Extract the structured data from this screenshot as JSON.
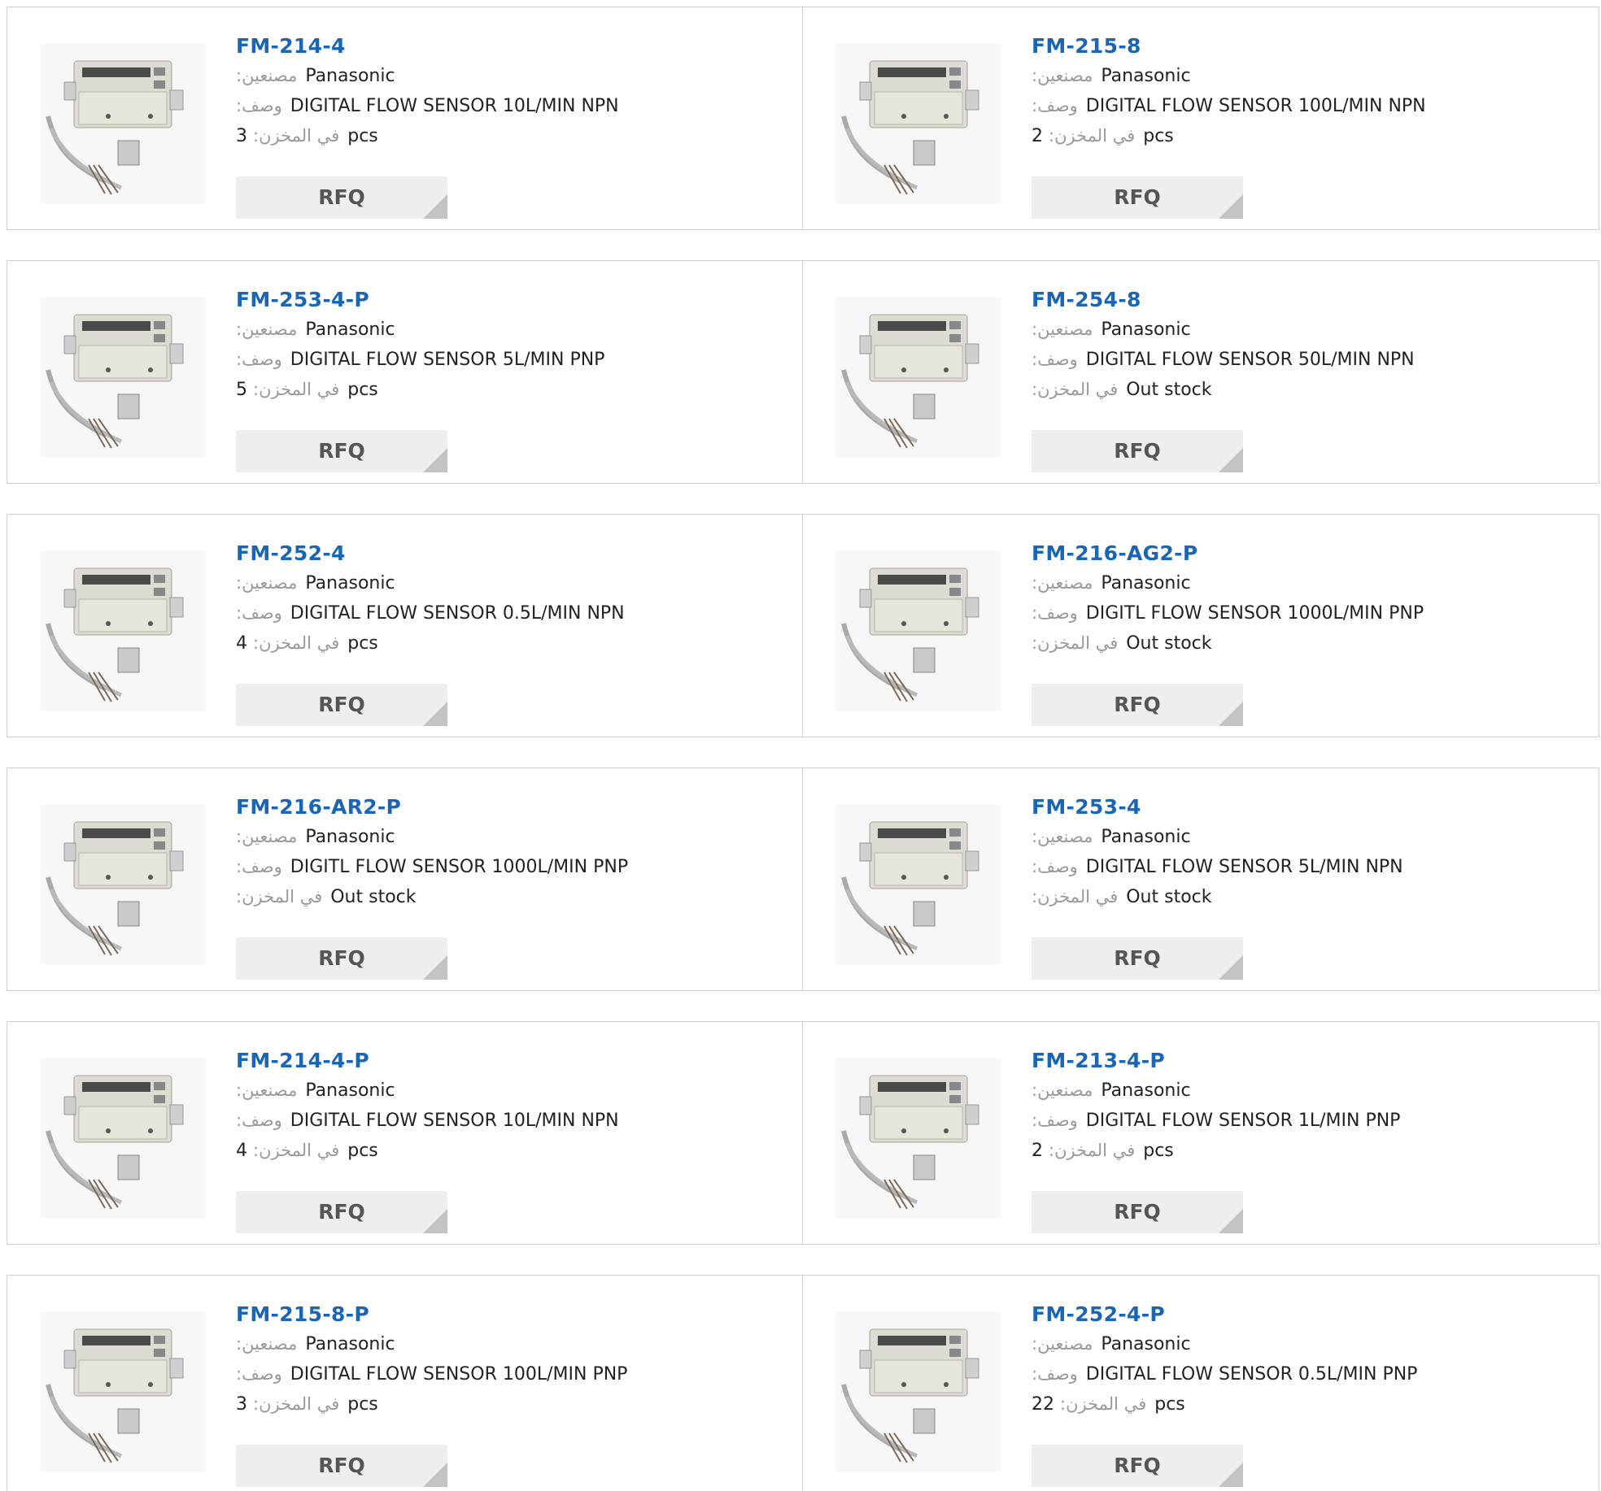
{
  "labels": {
    "manufacturer": ":مصنعين",
    "description": ":وصف",
    "stock": ":في المخزن",
    "unit": "pcs",
    "rfq": "RFQ"
  },
  "products": [
    {
      "part": "FM-214-4",
      "manufacturer": "Panasonic",
      "description": "DIGITAL FLOW SENSOR 10L/MIN NPN",
      "stock": "3",
      "in_stock": true
    },
    {
      "part": "FM-215-8",
      "manufacturer": "Panasonic",
      "description": "DIGITAL FLOW SENSOR 100L/MIN NPN",
      "stock": "2",
      "in_stock": true
    },
    {
      "part": "FM-253-4-P",
      "manufacturer": "Panasonic",
      "description": "DIGITAL FLOW SENSOR 5L/MIN PNP",
      "stock": "5",
      "in_stock": true
    },
    {
      "part": "FM-254-8",
      "manufacturer": "Panasonic",
      "description": "DIGITAL FLOW SENSOR 50L/MIN NPN",
      "stock": "Out stock",
      "in_stock": false
    },
    {
      "part": "FM-252-4",
      "manufacturer": "Panasonic",
      "description": "DIGITAL FLOW SENSOR 0.5L/MIN NPN",
      "stock": "4",
      "in_stock": true
    },
    {
      "part": "FM-216-AG2-P",
      "manufacturer": "Panasonic",
      "description": "DIGITL FLOW SENSOR 1000L/MIN PNP",
      "stock": "Out stock",
      "in_stock": false
    },
    {
      "part": "FM-216-AR2-P",
      "manufacturer": "Panasonic",
      "description": "DIGITL FLOW SENSOR 1000L/MIN PNP",
      "stock": "Out stock",
      "in_stock": false
    },
    {
      "part": "FM-253-4",
      "manufacturer": "Panasonic",
      "description": "DIGITAL FLOW SENSOR 5L/MIN NPN",
      "stock": "Out stock",
      "in_stock": false
    },
    {
      "part": "FM-214-4-P",
      "manufacturer": "Panasonic",
      "description": "DIGITAL FLOW SENSOR 10L/MIN NPN",
      "stock": "4",
      "in_stock": true
    },
    {
      "part": "FM-213-4-P",
      "manufacturer": "Panasonic",
      "description": "DIGITAL FLOW SENSOR 1L/MIN PNP",
      "stock": "2",
      "in_stock": true
    },
    {
      "part": "FM-215-8-P",
      "manufacturer": "Panasonic",
      "description": "DIGITAL FLOW SENSOR 100L/MIN PNP",
      "stock": "3",
      "in_stock": true
    },
    {
      "part": "FM-252-4-P",
      "manufacturer": "Panasonic",
      "description": "DIGITAL FLOW SENSOR 0.5L/MIN PNP",
      "stock": "22",
      "in_stock": true
    }
  ],
  "colors": {
    "link": "#1a66b3",
    "label": "#999999",
    "button_bg": "#eeeeee",
    "button_text": "#555555",
    "border": "#cfcfcf"
  }
}
